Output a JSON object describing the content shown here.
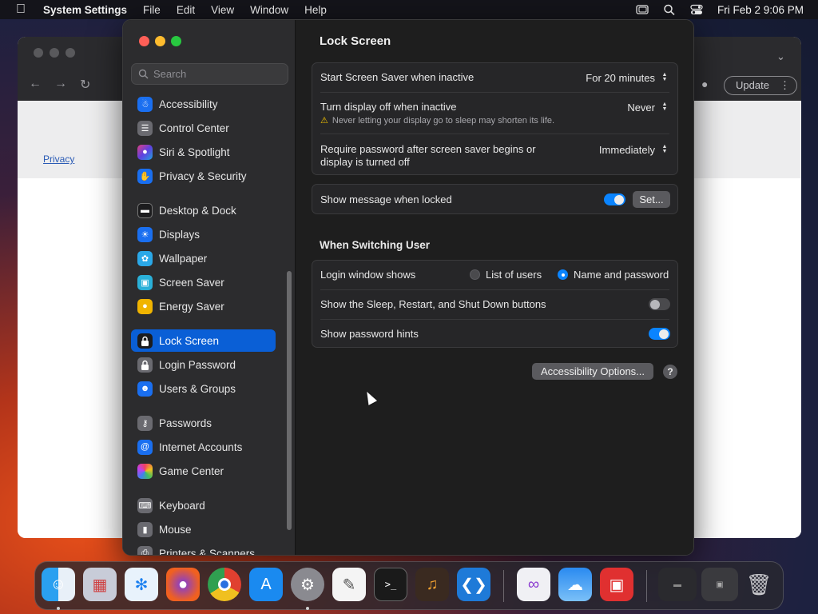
{
  "menubar": {
    "app_name": "System Settings",
    "menus": [
      "File",
      "Edit",
      "View",
      "Window",
      "Help"
    ],
    "clock": "Fri Feb 2  9:06 PM"
  },
  "browser": {
    "privacy_link": "Privacy",
    "update_button": "Update"
  },
  "sidebar": {
    "search_placeholder": "Search",
    "items": [
      {
        "label": "Accessibility",
        "icon": "accessibility-icon",
        "color": "#1a6ff0"
      },
      {
        "label": "Control Center",
        "icon": "control-center-icon",
        "color": "#6a6a70"
      },
      {
        "label": "Siri & Spotlight",
        "icon": "siri-icon",
        "color": "#b03ad0"
      },
      {
        "label": "Privacy & Security",
        "icon": "hand-icon",
        "color": "#1a6ff0"
      },
      {
        "label": "Desktop & Dock",
        "icon": "dock-icon",
        "color": "#1c1c1e"
      },
      {
        "label": "Displays",
        "icon": "displays-icon",
        "color": "#1a6ff0"
      },
      {
        "label": "Wallpaper",
        "icon": "wallpaper-icon",
        "color": "#2aa8e8"
      },
      {
        "label": "Screen Saver",
        "icon": "screen-saver-icon",
        "color": "#2ab0d8"
      },
      {
        "label": "Energy Saver",
        "icon": "energy-icon",
        "color": "#f0b400"
      },
      {
        "label": "Lock Screen",
        "icon": "lock-icon",
        "color": "#1c1c1e"
      },
      {
        "label": "Login Password",
        "icon": "login-lock-icon",
        "color": "#6a6a70"
      },
      {
        "label": "Users & Groups",
        "icon": "users-icon",
        "color": "#1a6ff0"
      },
      {
        "label": "Passwords",
        "icon": "key-icon",
        "color": "#6a6a70"
      },
      {
        "label": "Internet Accounts",
        "icon": "at-icon",
        "color": "#1a6ff0"
      },
      {
        "label": "Game Center",
        "icon": "game-center-icon",
        "color": "#e0e0e0"
      },
      {
        "label": "Keyboard",
        "icon": "keyboard-icon",
        "color": "#6a6a70"
      },
      {
        "label": "Mouse",
        "icon": "mouse-icon",
        "color": "#6a6a70"
      },
      {
        "label": "Printers & Scanners",
        "icon": "printer-icon",
        "color": "#6a6a70"
      }
    ]
  },
  "main": {
    "title": "Lock Screen",
    "screen_saver_label": "Start Screen Saver when inactive",
    "screen_saver_value": "For 20 minutes",
    "display_off_label": "Turn display off when inactive",
    "display_off_value": "Never",
    "display_off_warning": "Never letting your display go to sleep may shorten its life.",
    "require_password_label_1": "Require password after screen saver begins or",
    "require_password_label_2": "display is turned off",
    "require_password_value": "Immediately",
    "show_message_label": "Show message when locked",
    "show_message_on": true,
    "set_button": "Set...",
    "section_switching": "When Switching User",
    "login_window_label": "Login window shows",
    "option_list_of_users": "List of users",
    "option_name_password": "Name and password",
    "sleep_buttons_label": "Show the Sleep, Restart, and Shut Down buttons",
    "sleep_buttons_on": false,
    "password_hints_label": "Show password hints",
    "password_hints_on": true,
    "accessibility_options_button": "Accessibility Options...",
    "help_button": "?"
  },
  "dock": {
    "apps": [
      "Finder",
      "Launchpad",
      "Safari",
      "Firefox",
      "Chrome",
      "App Store",
      "System Settings",
      "TextEdit",
      "Terminal",
      "GarageBand",
      "VS Code",
      "Visual Studio",
      "Weather",
      "Photo Booth"
    ]
  }
}
